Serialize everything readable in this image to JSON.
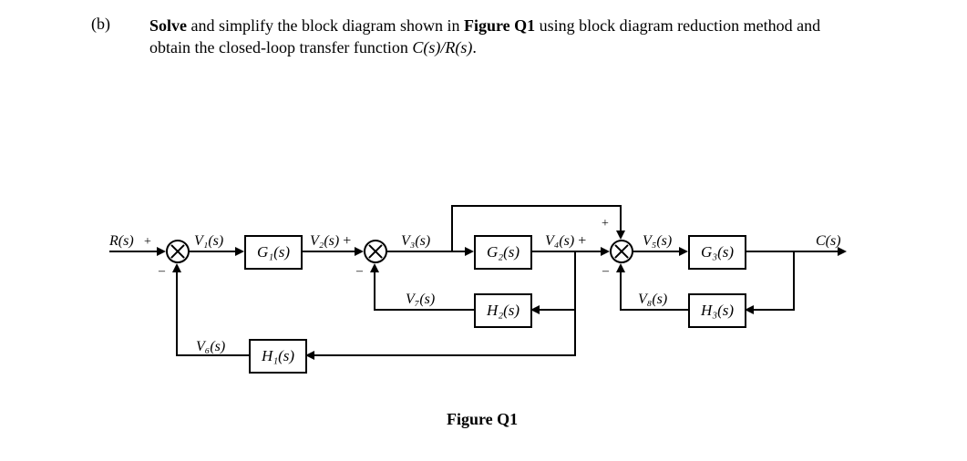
{
  "question": {
    "label": "(b)",
    "text_leading": "Solve",
    "text_mid1": " and simplify the block diagram shown in ",
    "text_bold1": "Figure Q1",
    "text_mid2": " using block diagram reduction method and obtain the closed-loop transfer function ",
    "text_ital": "C(s)/R(s)",
    "text_end": "."
  },
  "diagram": {
    "input": "R(s)",
    "output": "C(s)",
    "blocks": {
      "G1": "G₁(s)",
      "G2": "G₂(s)",
      "G3": "G₃(s)",
      "H1": "H₁(s)",
      "H2": "H₂(s)",
      "H3": "H₃(s)"
    },
    "signals": {
      "V1": "V₁(s)",
      "V2": "V₂(s)",
      "V3": "V₃(s)",
      "V4": "V₄(s)",
      "V5": "V₅(s)",
      "V6": "V₆(s)",
      "V7": "V₇(s)",
      "V8": "V₈(s)"
    },
    "plus": "+",
    "minus": "–"
  },
  "figure_caption": "Figure Q1",
  "chart_data": {
    "type": "block-diagram",
    "forward_path": [
      "R(s)",
      "Sum1",
      "G1(s)",
      "Sum2",
      "G2(s)",
      "Sum3",
      "G3(s)",
      "C(s)"
    ],
    "summing_junctions": {
      "Sum1": {
        "plus_inputs": [
          "R(s)"
        ],
        "minus_inputs": [
          "V6(s)"
        ],
        "output": "V1(s)"
      },
      "Sum2": {
        "plus_inputs": [
          "V2(s)"
        ],
        "minus_inputs": [
          "V7(s)"
        ],
        "output": "V3(s)"
      },
      "Sum3": {
        "plus_inputs": [
          "V4(s)",
          "V3(s)_feedforward"
        ],
        "minus_inputs": [
          "V8(s)"
        ],
        "output": "V5(s)"
      }
    },
    "blocks": {
      "G1(s)": {
        "in": "V1(s)",
        "out": "V2(s)"
      },
      "G2(s)": {
        "in": "V3(s)",
        "out": "V4(s)"
      },
      "G3(s)": {
        "in": "V5(s)",
        "out": "C(s)"
      },
      "H1(s)": {
        "in": "V4(s)_pickoff",
        "out": "V6(s)"
      },
      "H2(s)": {
        "in": "V4(s)_pickoff",
        "out": "V7(s)"
      },
      "H3(s)": {
        "in": "C(s)_pickoff",
        "out": "V8(s)"
      }
    },
    "feedforward": [
      {
        "from": "V3(s)",
        "to": "Sum3",
        "sign": "+"
      }
    ],
    "feedback": [
      {
        "from": "V4(s)",
        "through": "H2(s)",
        "to": "Sum2",
        "sign": "-"
      },
      {
        "from": "V4(s)",
        "through": "H1(s)",
        "to": "Sum1",
        "sign": "-"
      },
      {
        "from": "C(s)",
        "through": "H3(s)",
        "to": "Sum3",
        "sign": "-"
      }
    ]
  }
}
